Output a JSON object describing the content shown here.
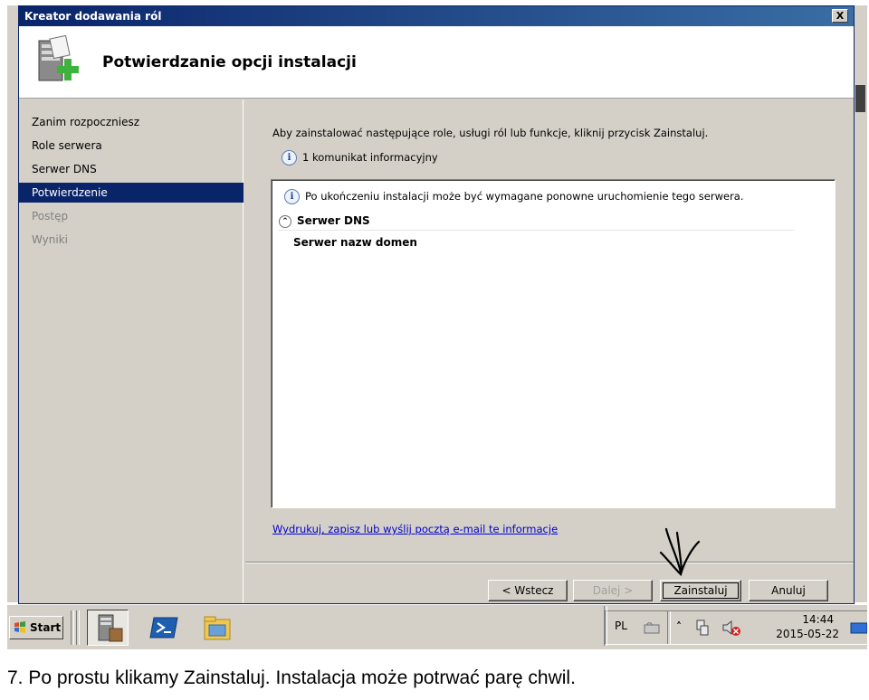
{
  "window": {
    "title": "Kreator dodawania ról",
    "close_label": "X",
    "header_title": "Potwierdzanie opcji instalacji"
  },
  "nav": {
    "items": [
      {
        "label": "Zanim rozpoczniesz",
        "state": "normal"
      },
      {
        "label": "Role serwera",
        "state": "normal"
      },
      {
        "label": "Serwer DNS",
        "state": "normal"
      },
      {
        "label": "Potwierdzenie",
        "state": "active"
      },
      {
        "label": "Postęp",
        "state": "disabled"
      },
      {
        "label": "Wyniki",
        "state": "disabled"
      }
    ]
  },
  "content": {
    "intro": "Aby zainstalować następujące role, usługi ról lub funkcje, kliknij przycisk Zainstaluj.",
    "info_count": "1 komunikat informacyjny",
    "details": {
      "note": "Po ukończeniu instalacji może być wymagane ponowne uruchomienie tego serwera.",
      "section_title": "Serwer DNS",
      "section_item": "Serwer nazw domen"
    },
    "print_link": "Wydrukuj, zapisz lub wyślij pocztą e-mail te informacje"
  },
  "buttons": {
    "back": "< Wstecz",
    "next": "Dalej >",
    "install": "Zainstaluj",
    "cancel": "Anuluj"
  },
  "taskbar": {
    "start_label": "Start",
    "language": "PL",
    "time": "14:44",
    "date": "2015-05-22",
    "icons": [
      "server-manager-icon",
      "powershell-icon",
      "explorer-icon"
    ]
  },
  "caption": "7. Po prostu klikamy Zainstaluj. Instalacja może potrwać parę chwil.",
  "colors": {
    "title_bar": "#0a246a",
    "selected_nav": "#0a246a",
    "face": "#d4d0c8",
    "link": "#0000cc"
  }
}
